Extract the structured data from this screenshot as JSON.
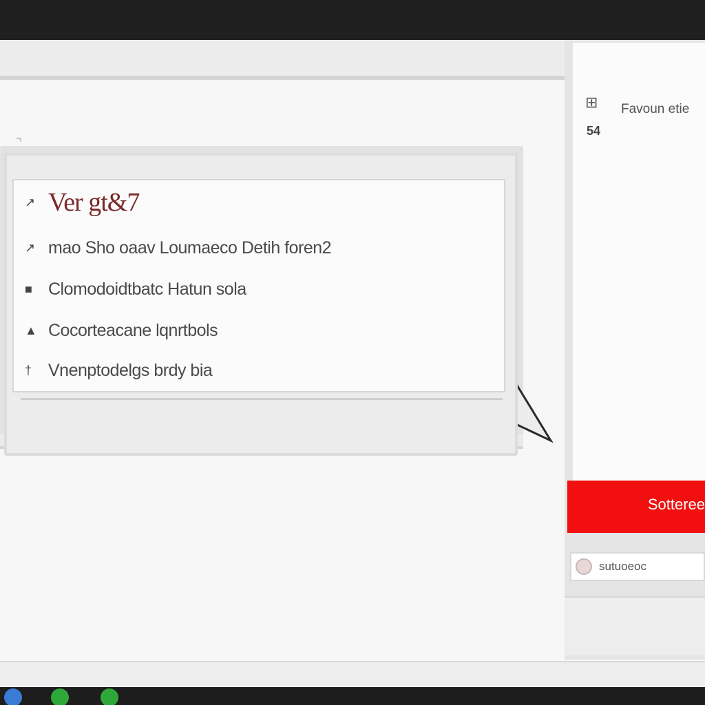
{
  "popup": {
    "title": "Ver gt&7",
    "items": [
      {
        "marker": "↗",
        "text": "mao Sho oaav Loumaeco Detih foren2"
      },
      {
        "marker": "■",
        "text": "Clomodoidtbatc Hatun sola"
      },
      {
        "marker": "▲",
        "text": "Cocorteacane lqnrtbols"
      },
      {
        "marker": "†",
        "text": "Vnenptodelgs brdy bia"
      }
    ]
  },
  "side_panel": {
    "icon_glyph": "⊞",
    "title": "Favoun etie",
    "number": "54",
    "action_button_label": "Sotteree",
    "search_text": "sutuoeoc"
  },
  "colors": {
    "accent_red": "#f10f0f",
    "title_red": "#7a2a2a"
  },
  "taskbar": {
    "icons": [
      "blue-app-icon",
      "green-app-icon",
      "green-app-icon"
    ]
  }
}
